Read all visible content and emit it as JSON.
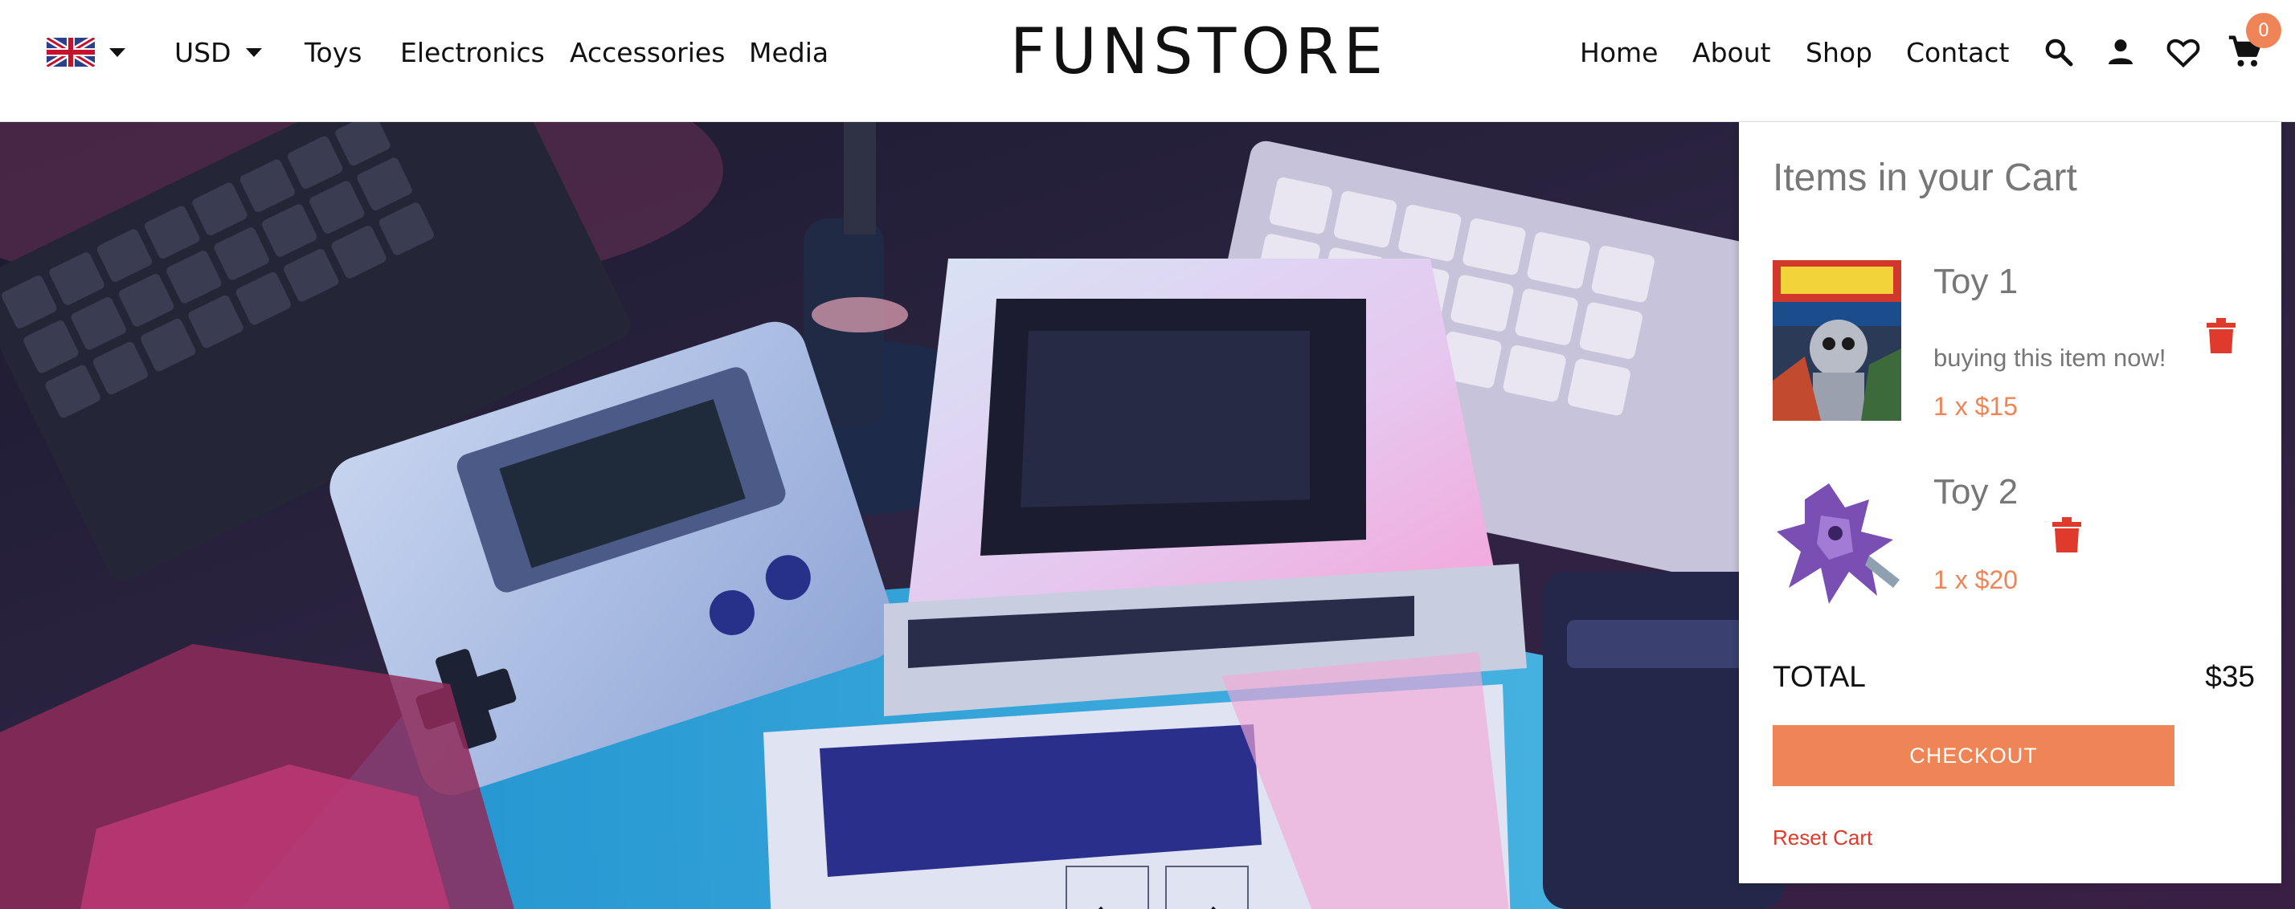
{
  "header": {
    "language_icon": "uk-flag-icon",
    "currency": "USD",
    "left_nav": [
      "Toys",
      "Electronics",
      "Accessories",
      "Media"
    ],
    "logo": "FUNSTORE",
    "right_nav": [
      "Home",
      "About",
      "Shop",
      "Contact"
    ],
    "icons": [
      "search-icon",
      "user-icon",
      "heart-icon",
      "cart-icon"
    ],
    "cart_count": "0"
  },
  "hero": {
    "image": "retro computers and handheld game console under pink and blue light",
    "prev_icon": "arrow-left-icon",
    "next_icon": "arrow-right-icon",
    "prev_glyph": "←",
    "next_glyph": "→"
  },
  "cart": {
    "title": "Items in your Cart",
    "items": [
      {
        "name": "Toy 1",
        "note": "buying this item now!",
        "quantity": "1 x $15"
      },
      {
        "name": "Toy 2",
        "note": "",
        "quantity": "1 x $20"
      }
    ],
    "total_label": "TOTAL",
    "total_value": "$35",
    "checkout_label": "CHECKOUT",
    "reset_label": "Reset Cart"
  },
  "colors": {
    "accent": "#ef8556",
    "danger": "#e03a2c",
    "muted_text": "#777777"
  }
}
